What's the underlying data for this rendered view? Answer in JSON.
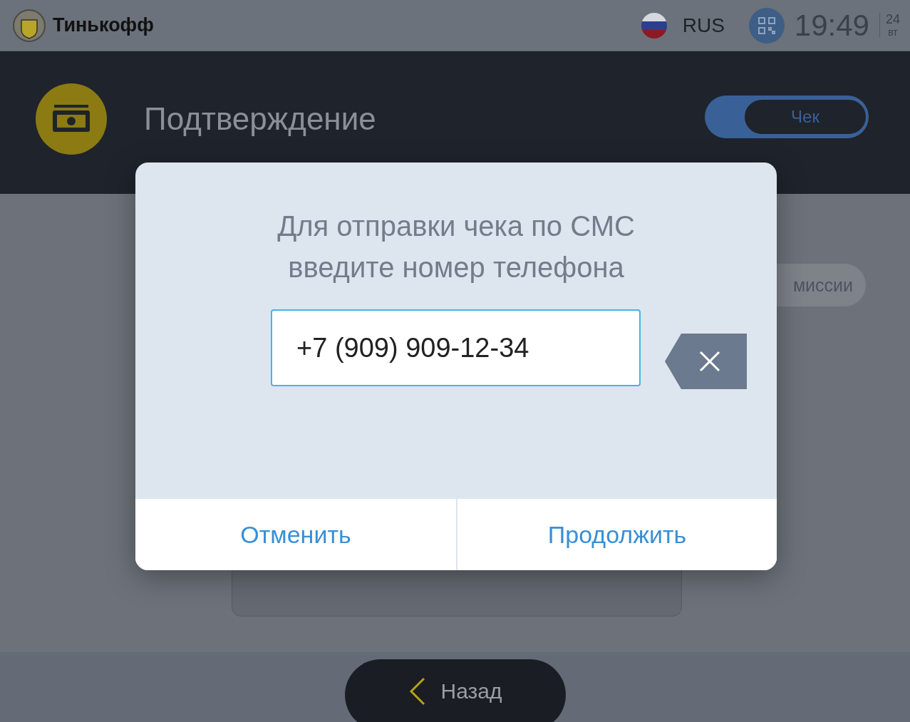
{
  "status_bar": {
    "brand": "Тинькофф",
    "language": "RUS",
    "time": "19:49",
    "date_day": "24",
    "date_weekday": "вт"
  },
  "header": {
    "title": "Подтверждение",
    "receipt_toggle": "Чек"
  },
  "background": {
    "pill_label": "миссии"
  },
  "dialog": {
    "message": "Для отправки чека по СМС\nвведите номер телефона",
    "phone_value": "+7 (909) 909-12-34",
    "buttons": [
      "Отменить",
      "Продолжить"
    ]
  },
  "footer": {
    "back_button": "Назад"
  }
}
